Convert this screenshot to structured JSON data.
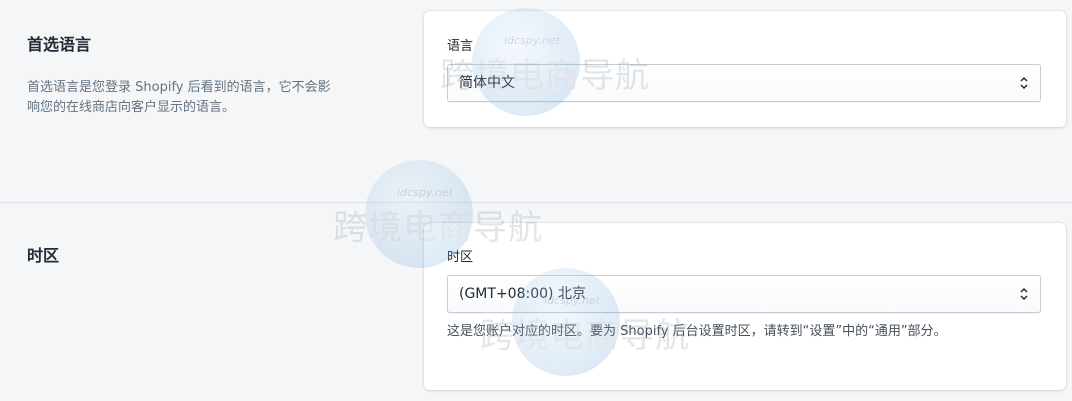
{
  "language_section": {
    "title": "首选语言",
    "description": "首选语言是您登录 Shopify 后看到的语言，它不会影响您的在线商店向客户显示的语言。",
    "field_label": "语言",
    "selected_value": "简体中文"
  },
  "timezone_section": {
    "title": "时区",
    "field_label": "时区",
    "selected_value": "(GMT+08:00) 北京",
    "help_text": "这是您账户对应的时区。要为 Shopify 后台设置时区，请转到“设置”中的“通用”部分。"
  },
  "watermark": {
    "domain": "idcspy.net",
    "text": "跨境电商导航"
  },
  "icons": {
    "select_arrows": "up-down-chevron-icon",
    "watermark_logo": "globe-logo"
  },
  "colors": {
    "page_background": "#f4f6f8",
    "card_background": "#ffffff",
    "text_primary": "#212b36",
    "text_secondary": "#637381",
    "border": "#c4cdd5",
    "divider": "#dfe3e8"
  }
}
